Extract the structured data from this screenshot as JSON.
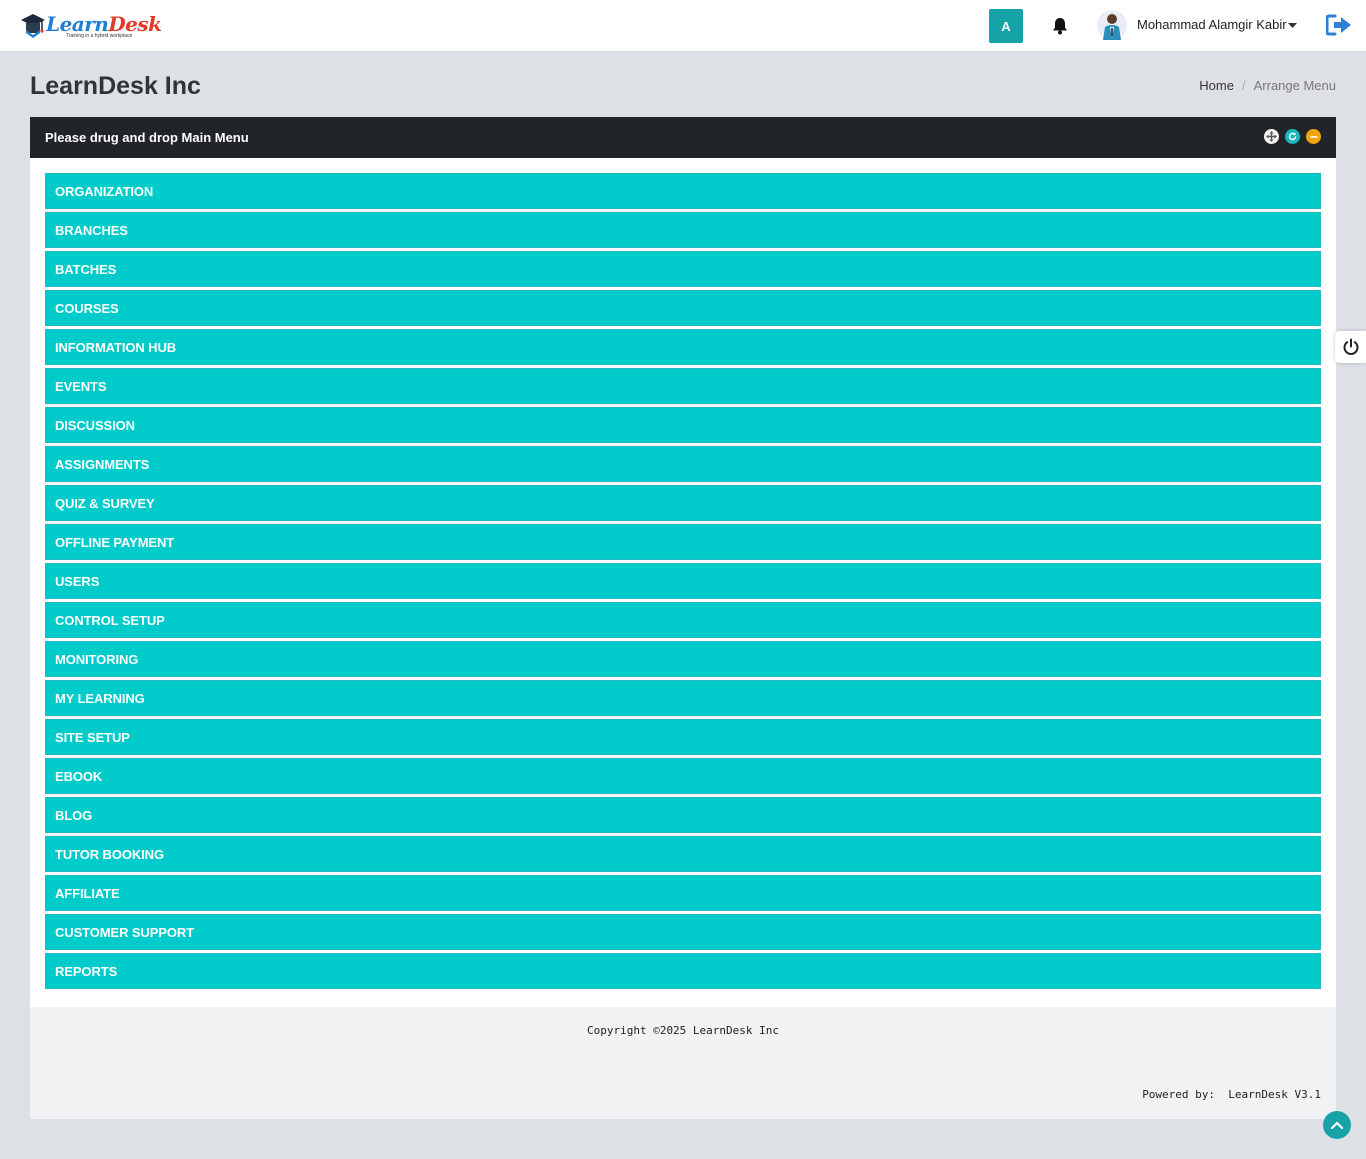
{
  "header": {
    "logo_text_part1": "Learn",
    "logo_text_part2": "Desk",
    "logo_tagline": "Training in a hybrid workplace",
    "avatar_letter": "A",
    "user_name": "Mohammad Alamgir Kabir"
  },
  "page": {
    "title": "LearnDesk Inc",
    "breadcrumb": {
      "home": "Home",
      "separator": "/",
      "current": "Arrange Menu"
    }
  },
  "card": {
    "title": "Please drug and drop Main Menu"
  },
  "menu_items": [
    "ORGANIZATION",
    "BRANCHES",
    "BATCHES",
    "COURSES",
    "INFORMATION HUB",
    "EVENTS",
    "DISCUSSION",
    "ASSIGNMENTS",
    "QUIZ & SURVEY",
    "OFFLINE PAYMENT",
    "USERS",
    "CONTROL SETUP",
    "MONITORING",
    "MY LEARNING",
    "SITE SETUP",
    "EBOOK",
    "BLOG",
    "TUTOR BOOKING",
    "AFFILIATE",
    "CUSTOMER SUPPORT",
    "REPORTS"
  ],
  "footer": {
    "copyright": "Copyright ©2025 LearnDesk Inc",
    "powered_by": "Powered by:  LearnDesk V3.1"
  },
  "colors": {
    "menu_item_bg": "#00cbcb",
    "card_header_bg": "#212529",
    "accent": "#17a2a8",
    "logout_icon": "#2f80d9"
  }
}
